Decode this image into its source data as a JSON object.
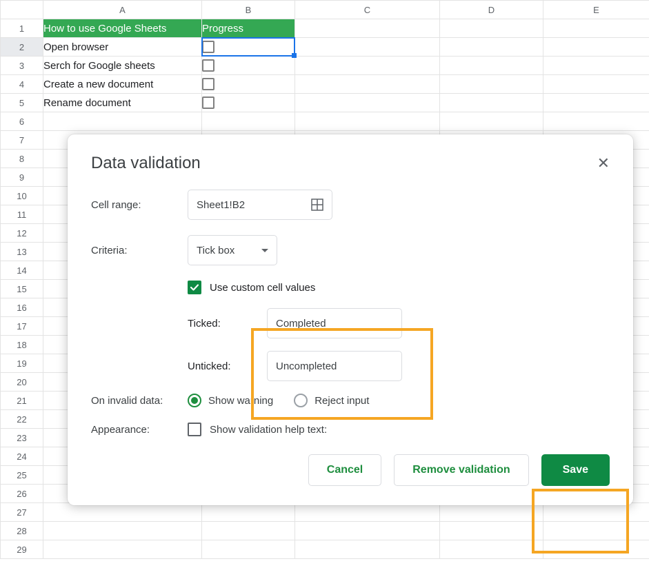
{
  "sheet": {
    "columns": [
      "A",
      "B",
      "C",
      "D",
      "E"
    ],
    "row_numbers": [
      1,
      2,
      3,
      4,
      5,
      6,
      7,
      8,
      9,
      10,
      11,
      12,
      13,
      14,
      15,
      16,
      17,
      18,
      19,
      20,
      21,
      22,
      23,
      24,
      25,
      26,
      27,
      28,
      29
    ],
    "header": {
      "a": "How to use Google Sheets",
      "b": "Progress"
    },
    "rows": [
      {
        "a": "Open browser"
      },
      {
        "a": "Serch for Google sheets"
      },
      {
        "a": "Create a new document"
      },
      {
        "a": "Rename document"
      }
    ],
    "selected_cell": "B2"
  },
  "dialog": {
    "title": "Data validation",
    "cell_range_label": "Cell range:",
    "cell_range_value": "Sheet1!B2",
    "criteria_label": "Criteria:",
    "criteria_value": "Tick box",
    "use_custom_label": "Use custom cell values",
    "use_custom_checked": true,
    "ticked_label": "Ticked:",
    "ticked_value": "Completed",
    "unticked_label": "Unticked:",
    "unticked_value": "Uncompleted",
    "invalid_label": "On invalid data:",
    "show_warning": "Show warning",
    "reject_input": "Reject input",
    "invalid_choice": "show_warning",
    "appearance_label": "Appearance:",
    "show_help_text": "Show validation help text:",
    "cancel": "Cancel",
    "remove": "Remove validation",
    "save": "Save"
  }
}
